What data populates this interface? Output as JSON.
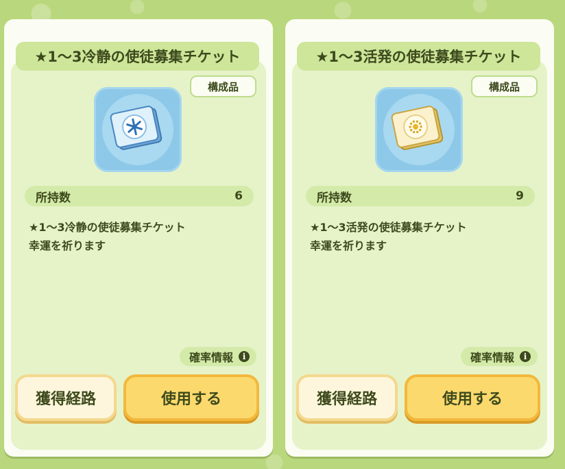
{
  "cards": [
    {
      "title": "★1〜3冷静の使徒募集チケット",
      "badge": "構成品",
      "icon": "blue-snowflake-ticket",
      "owned_label": "所持数",
      "owned_count": "6",
      "desc_line1": "★1〜3冷静の使徒募集チケット",
      "desc_line2": "幸運を祈ります",
      "prob_label": "確率情報",
      "route_button": "獲得経路",
      "use_button": "使用する"
    },
    {
      "title": "★1〜3活発の使徒募集チケット",
      "badge": "構成品",
      "icon": "yellow-sun-ticket",
      "owned_label": "所持数",
      "owned_count": "9",
      "desc_line1": "★1〜3活発の使徒募集チケット",
      "desc_line2": "幸運を祈ります",
      "prob_label": "確率情報",
      "route_button": "獲得経路",
      "use_button": "使用する"
    }
  ],
  "colors": {
    "background": "#b9d77c",
    "card": "#fbfcf3",
    "panel": "#e6f3c9",
    "text": "#3d4a1c",
    "use_button": "#fcd96d",
    "route_button": "#fdf6dc"
  }
}
